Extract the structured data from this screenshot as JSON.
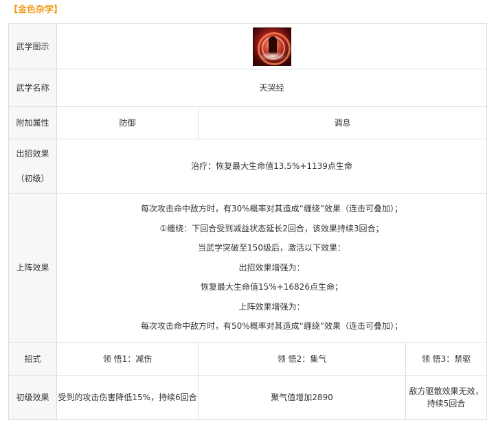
{
  "section_title": "【金色杂学】",
  "rows": {
    "icon_label": "武学图示",
    "name_label": "武学名称",
    "name_value": "天哭经",
    "attr_label": "附加属性",
    "attr_values": [
      "防御",
      "调息"
    ],
    "attack_label_line1": "出招效果",
    "attack_label_line2": "（初级）",
    "attack_value": "治疗：恢复最大生命值13.5%+1139点生命",
    "formation_label": "上阵效果",
    "formation_lines": [
      "每次攻击命中敌方时，有30%概率对其造成“缠绕”效果（连击可叠加）；",
      "①缠绕：下回合受到减益状态延长2回合，该效果持续3回合；",
      "当武学突破至150级后，激活以下效果：",
      "出招效果增强为：",
      "恢复最大生命值15%+16826点生命；",
      "上阵效果增强为：",
      "每次攻击命中敌方时，有50%概率对其造成“缠绕”效果（连击可叠加）；"
    ],
    "moves_label": "招式",
    "moves": [
      "领 悟1：减伤",
      "领 悟2：集气",
      "领 悟3：禁驱"
    ],
    "initial_label": "初级效果",
    "initial_effects": [
      "受到的攻击伤害降低15%，持续6回合",
      "聚气值增加2890",
      "敌方驱散效果无效，持续5回合"
    ]
  },
  "icon": {
    "name": "martial-art-tiankujing-icon",
    "accent": "#c0281e"
  },
  "colors": {
    "title": "#f29a1b",
    "label_bg": "#f7f7f7",
    "border": "#dcdcdc"
  }
}
